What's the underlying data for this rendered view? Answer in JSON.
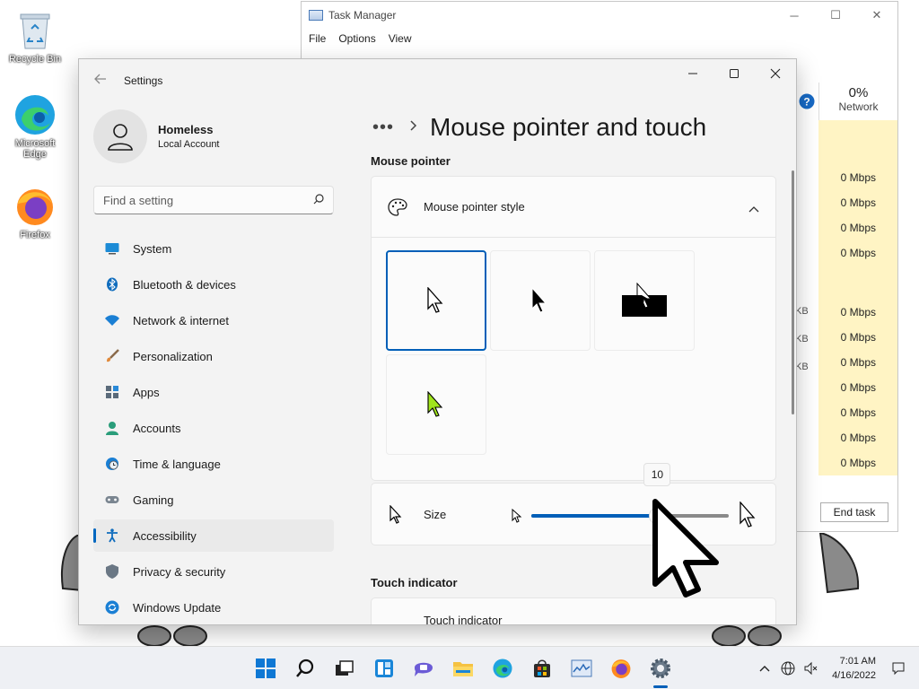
{
  "desktop": {
    "icons": [
      {
        "label": "Recycle Bin"
      },
      {
        "label": "Microsoft Edge"
      },
      {
        "label": "Firefox"
      }
    ]
  },
  "task_manager": {
    "title": "Task Manager",
    "menu": [
      "File",
      "Options",
      "View"
    ],
    "network": {
      "percent": "0%",
      "label": "Network",
      "rows": [
        "0 Mbps",
        "0 Mbps",
        "0 Mbps",
        "0 Mbps",
        "0 Mbps",
        "0 Mbps",
        "0 Mbps",
        "0 Mbps",
        "0 Mbps",
        "0 Mbps",
        "0 Mbps"
      ]
    },
    "kb_labels": [
      "KB",
      "KB",
      "KB"
    ],
    "end_task_label": "End task"
  },
  "settings": {
    "window_title": "Settings",
    "profile": {
      "name": "Homeless",
      "account_type": "Local Account"
    },
    "search": {
      "placeholder": "Find a setting"
    },
    "nav": [
      {
        "label": "System",
        "icon": "monitor-icon"
      },
      {
        "label": "Bluetooth & devices",
        "icon": "bluetooth-icon"
      },
      {
        "label": "Network & internet",
        "icon": "wifi-icon"
      },
      {
        "label": "Personalization",
        "icon": "brush-icon"
      },
      {
        "label": "Apps",
        "icon": "apps-icon"
      },
      {
        "label": "Accounts",
        "icon": "person-icon"
      },
      {
        "label": "Time & language",
        "icon": "clock-globe-icon"
      },
      {
        "label": "Gaming",
        "icon": "controller-icon"
      },
      {
        "label": "Accessibility",
        "icon": "accessibility-icon"
      },
      {
        "label": "Privacy & security",
        "icon": "shield-icon"
      },
      {
        "label": "Windows Update",
        "icon": "update-icon"
      }
    ],
    "active_nav": "Accessibility",
    "breadcrumb": {
      "more": "•••",
      "title": "Mouse pointer and touch"
    },
    "sections": {
      "mouse_pointer": "Mouse pointer",
      "touch_indicator": "Touch indicator"
    },
    "pointer_style": {
      "label": "Mouse pointer style",
      "options": [
        "white",
        "black",
        "inverted",
        "custom"
      ],
      "selected": "white",
      "custom_color": "#a0e41c"
    },
    "size": {
      "label": "Size",
      "value": 10,
      "min": 1,
      "max": 15,
      "display": "10"
    },
    "touch_indicator_row": {
      "label": "Touch indicator"
    }
  },
  "taskbar": {
    "apps": [
      "start-icon",
      "search-icon",
      "task-view-icon",
      "widgets-icon",
      "chat-icon",
      "file-explorer-icon",
      "edge-icon",
      "store-icon",
      "task-manager-icon",
      "firefox-icon",
      "settings-icon"
    ],
    "active_app": "settings-icon",
    "time": "7:01 AM",
    "date": "4/16/2022"
  },
  "colors": {
    "accent": "#005fb8",
    "window_bg": "#f3f3f3",
    "card_bg": "#fbfbfb",
    "tm_highlight": "#fff4c4"
  }
}
